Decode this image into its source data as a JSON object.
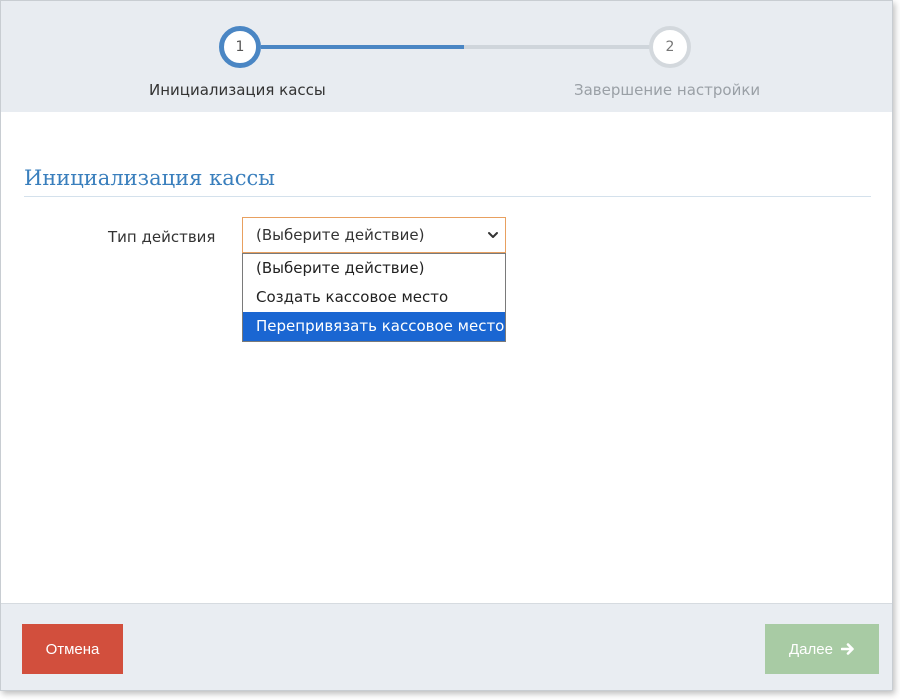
{
  "stepper": {
    "steps": [
      {
        "number": "1",
        "label": "Инициализация кассы",
        "state": "active"
      },
      {
        "number": "2",
        "label": "Завершение настройки",
        "state": "inactive"
      }
    ]
  },
  "section": {
    "title": "Инициализация кассы"
  },
  "form": {
    "action_type_label": "Тип действия",
    "action_type_value": "(Выберите действие)",
    "action_type_options": [
      "(Выберите действие)",
      "Создать кассовое место",
      "Перепривязать кассовое место"
    ],
    "highlighted_option_index": 2
  },
  "footer": {
    "cancel_label": "Отмена",
    "next_label": "Далее"
  },
  "colors": {
    "accent": "#4a86c4",
    "cancel": "#d24f3d",
    "next_disabled": "#a8cba4",
    "option_highlight": "#1a66d2"
  },
  "icons": {
    "select_chevron": "chevron-down-icon",
    "next_arrow": "arrow-right-icon"
  }
}
